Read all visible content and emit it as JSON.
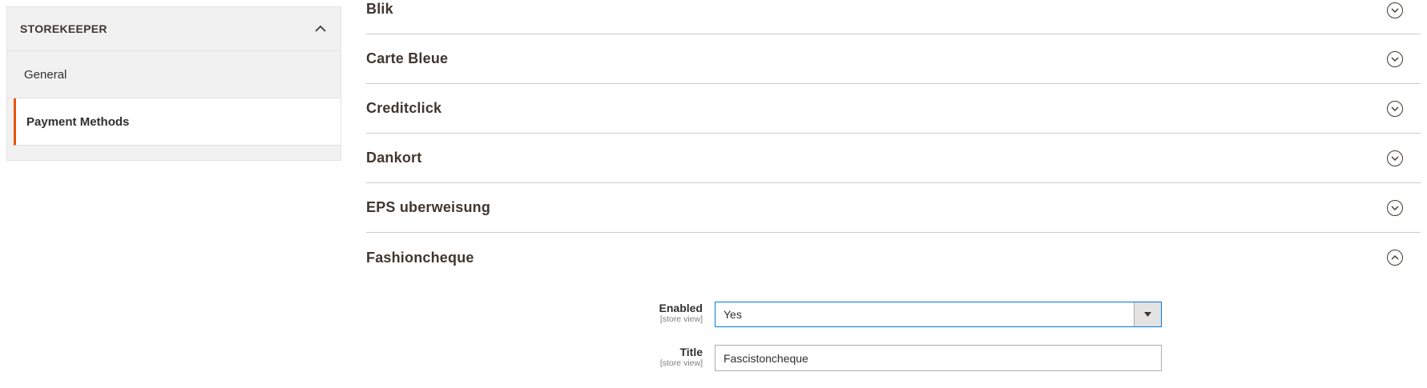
{
  "sidebar": {
    "header": "STOREKEEPER",
    "items": [
      {
        "label": "General",
        "active": false
      },
      {
        "label": "Payment Methods",
        "active": true
      }
    ]
  },
  "sections": [
    {
      "title": "Blik",
      "state": "collapsed"
    },
    {
      "title": "Carte Bleue",
      "state": "collapsed"
    },
    {
      "title": "Creditclick",
      "state": "collapsed"
    },
    {
      "title": "Dankort",
      "state": "collapsed"
    },
    {
      "title": "EPS uberweisung",
      "state": "collapsed"
    },
    {
      "title": "Fashioncheque",
      "state": "expanded"
    }
  ],
  "form": {
    "enabled": {
      "label": "Enabled",
      "scope": "[store view]",
      "value": "Yes"
    },
    "title": {
      "label": "Title",
      "scope": "[store view]",
      "value": "Fascistoncheque"
    }
  },
  "colors": {
    "accent": "#eb5202",
    "focus_border": "#007bdb"
  }
}
